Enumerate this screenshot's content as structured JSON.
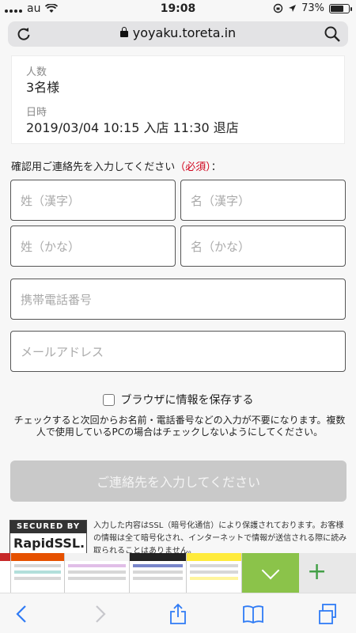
{
  "status_bar": {
    "carrier": "au",
    "time": "19:08",
    "battery": "73%",
    "battery_level": 0.73
  },
  "url_bar": {
    "url": "yoyaku.toreta.in"
  },
  "summary": {
    "people_label": "人数",
    "people_value": "3名様",
    "datetime_label": "日時",
    "datetime_value": "2019/03/04 10:15 入店 11:30 退店"
  },
  "form": {
    "intro": "確認用ご連絡先を入力してください",
    "required": "（必須）",
    "intro_suffix": "：",
    "last_kanji_placeholder": "姓（漢字）",
    "first_kanji_placeholder": "名（漢字）",
    "last_kana_placeholder": "姓（かな）",
    "first_kana_placeholder": "名（かな）",
    "phone_placeholder": "携帯電話番号",
    "email_placeholder": "メールアドレス",
    "save_label": "ブラウザに情報を保存する",
    "note": "チェックすると次回からお名前・電話番号などの入力が不要になります。複数人で使用しているPCの場合はチェックしないようにしてください。",
    "submit_label": "ご連絡先を入力してください"
  },
  "ssl": {
    "badge_top": "SECURED BY",
    "badge_brand": "RapidSSL.",
    "text": "入力した内容はSSL（暗号化通信）により保護されております。お客様の情報は全て暗号化され、インターネットで情報が送信される際に読み取られることはありません。"
  },
  "colors": {
    "required": "#d0021b",
    "accent_green": "#8bc34a",
    "button_disabled": "#c9c9c9"
  },
  "toolbar": {
    "icons": [
      "back-icon",
      "forward-icon",
      "share-icon",
      "bookmarks-icon",
      "tabs-icon"
    ]
  }
}
